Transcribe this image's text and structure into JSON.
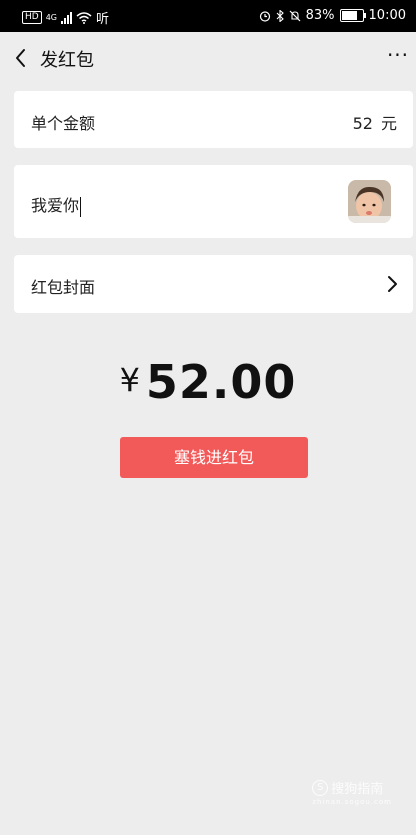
{
  "status_bar": {
    "network": "HD",
    "signal_gen": "4G",
    "extra_icon": "听",
    "battery_percent": "83%",
    "time": "10:00"
  },
  "navbar": {
    "title": "发红包",
    "more_label": "···"
  },
  "amount_row": {
    "label": "单个金额",
    "value": "52",
    "unit": "元"
  },
  "message_row": {
    "text": "我爱你"
  },
  "cover_row": {
    "label": "红包封面"
  },
  "total": {
    "currency": "¥",
    "amount": "52.00"
  },
  "send_button": {
    "label": "塞钱进红包"
  },
  "watermark": {
    "text": "搜狗指南",
    "sub": "zhinan.sogou.com"
  },
  "colors": {
    "accent": "#f25a5a",
    "background": "#ededed"
  }
}
